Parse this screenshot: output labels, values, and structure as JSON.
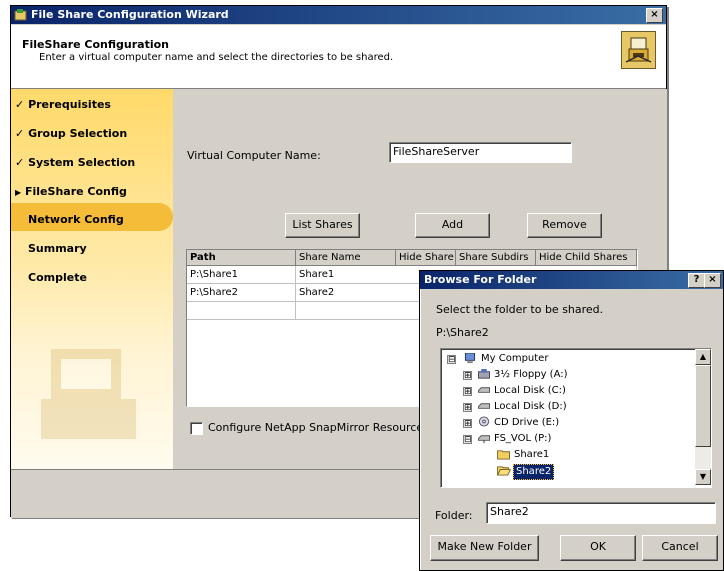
{
  "wizard": {
    "title": "File Share Configuration Wizard",
    "close": "×",
    "header_title": "FileShare Configuration",
    "header_subtitle": "Enter a virtual computer name and select the directories to be shared.",
    "sidebar": [
      {
        "label": "Prerequisites",
        "marker": "✓"
      },
      {
        "label": "Group Selection",
        "marker": "✓"
      },
      {
        "label": "System Selection",
        "marker": "✓"
      },
      {
        "label": "FileShare Config",
        "marker": "▶"
      },
      {
        "label": "Network Config",
        "marker": ""
      },
      {
        "label": "Summary",
        "marker": ""
      },
      {
        "label": "Complete",
        "marker": ""
      }
    ],
    "vcn_label": "Virtual Computer Name:",
    "vcn_value": "FileShareServer",
    "buttons": {
      "list_shares": "List Shares",
      "add": "Add",
      "remove": "Remove"
    },
    "grid": {
      "headers": [
        "Path",
        "Share Name",
        "Hide Share",
        "Share Subdirs",
        "Hide Child Shares"
      ],
      "rows": [
        [
          "P:\\Share1",
          "Share1"
        ],
        [
          "P:\\Share2",
          "Share2"
        ]
      ]
    },
    "snapmirror_label": "Configure NetApp SnapMirror Resource(s)"
  },
  "dialog": {
    "title": "Browse For Folder",
    "help": "?",
    "close": "×",
    "instruction": "Select the folder to be shared.",
    "current_path": "P:\\Share2",
    "tree": [
      {
        "label": "My Computer",
        "exp": "⊟",
        "icon": "computer-icon"
      },
      {
        "label": "3½ Floppy (A:)",
        "exp": "⊞",
        "icon": "floppy-drive-icon"
      },
      {
        "label": "Local Disk (C:)",
        "exp": "⊞",
        "icon": "hard-drive-icon"
      },
      {
        "label": "Local Disk (D:)",
        "exp": "⊞",
        "icon": "hard-drive-icon"
      },
      {
        "label": "CD Drive (E:)",
        "exp": "⊞",
        "icon": "cd-drive-icon"
      },
      {
        "label": "FS_VOL (P:)",
        "exp": "⊟",
        "icon": "network-drive-icon"
      },
      {
        "label": "Share1",
        "exp": "",
        "icon": "folder-icon"
      },
      {
        "label": "Share2",
        "exp": "",
        "icon": "folder-open-icon"
      }
    ],
    "folder_label": "Folder:",
    "folder_value": "Share2",
    "buttons": {
      "make_new_folder": "Make New Folder",
      "ok": "OK",
      "cancel": "Cancel"
    }
  },
  "colors": {
    "accent": "#0a246a",
    "selection": "#0a246a",
    "sidebar_highlight": "#f5bc3a"
  }
}
